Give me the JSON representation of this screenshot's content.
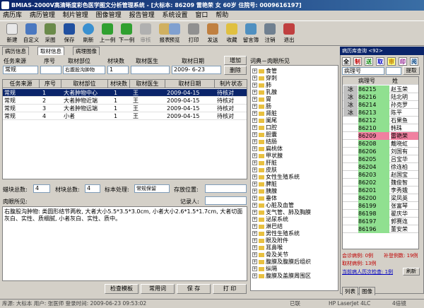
{
  "title": "BMIAS-2000V高清晰度彩色医学图文分析管理系统 - [大标本: 86209 雷艳荣 女 60岁 住院号: 0009616197]",
  "menu": [
    "病历库",
    "病历管理",
    "制片管理",
    "图像管理",
    "报告管理",
    "系统设置",
    "窗口",
    "帮助"
  ],
  "toolbar": [
    "新建",
    "自定义",
    "采图",
    "保存",
    "刷新",
    "上一例",
    "下一例",
    "审核",
    "报表",
    "预览",
    "打印",
    "发送",
    "收藏",
    "留言簿",
    "注销",
    "退出"
  ],
  "tabs": [
    "病历信息",
    "取材信息",
    "病理图像"
  ],
  "form": {
    "h_source": "任务来源",
    "h_seq": "序号",
    "h_part": "取材部位",
    "h_blocks": "材块数",
    "h_doctor": "取材医生",
    "h_date": "取材日期",
    "v_source": "常规",
    "v_part": "右腹股沟肿物",
    "v_blocks": "1",
    "v_date": "2009- 6-23",
    "add_btn": "增加",
    "del_btn": "删除"
  },
  "grid": {
    "headers": [
      "任务来源",
      "序号",
      "取材部位",
      "材块数",
      "取材医生",
      "取材日期",
      "制片状态"
    ],
    "rows": [
      [
        "常规",
        "1",
        "大者肿物中心",
        "1",
        "王",
        "2009-04-15",
        "待核对"
      ],
      [
        "常规",
        "2",
        "大者肿物近端",
        "1",
        "王",
        "2009-04-15",
        "待核对"
      ],
      [
        "常规",
        "3",
        "大者肿物远端",
        "1",
        "王",
        "2009-04-15",
        "待核对"
      ],
      [
        "常规",
        "4",
        "小者",
        "1",
        "王",
        "2009-04-15",
        "待核对"
      ]
    ]
  },
  "summary": {
    "l_wax": "蜡块总数:",
    "v_wax": "4",
    "l_material": "材块总数:",
    "v_material": "4",
    "l_proc": "标本处理:",
    "v_proc": "常规保留",
    "l_loc": "存放位置:",
    "l_naked": "肉眼所见:",
    "l_recorder": "记录人:"
  },
  "description": "右腹股沟肿物: 类圆形结节两枚, 大者大小5.5*3.5*3.0cm, 小者大小2.6*1.5*1.7cm, 大者切面灰白、实性、质细腻, 小者灰白、实性、质中。",
  "bottom_buttons": [
    "检查模板",
    "常用词",
    "保 存",
    "打 印"
  ],
  "tree_title": "词典－肉眼所见",
  "tree": [
    "食管",
    "穿刺",
    "肺",
    "乳腺",
    "胃",
    "肠",
    "肾脏",
    "阑尾",
    "口腔",
    "胆囊",
    "结肠",
    "扁桃体",
    "甲状腺",
    "肝脏",
    "皮肤",
    "女性生殖系统",
    "脾脏",
    "胰腺",
    "垂体",
    "心脏及血管",
    "支气管、肺及胸膜",
    "泌尿系统",
    "淋巴结",
    "男性生殖系统",
    "眼及附件",
    "耳鼻喉",
    "骨及关节",
    "腹膜及腹膜后组织",
    "纵隔",
    "腹膜及盖膜周围区"
  ],
  "right": {
    "title": "病历库查询 <92>",
    "letters": [
      "全",
      "制",
      "送",
      "取",
      "审",
      "印",
      "阅"
    ],
    "search_field": "病理号",
    "refresh_btn": "提取",
    "col_no": "病理号",
    "col_name": "姓",
    "patients": [
      [
        "冰",
        "86215",
        "赵玉荣"
      ],
      [
        "冰",
        "86216",
        "陆北明"
      ],
      [
        "冰",
        "86214",
        "孙克罗"
      ],
      [
        "冰",
        "86213",
        "陈平"
      ],
      [
        "",
        "86212",
        "石果鱼"
      ],
      [
        "",
        "86210",
        "韩珠"
      ],
      [
        "",
        "86209",
        "雷艳荣"
      ],
      [
        "",
        "86208",
        "戴晓虹"
      ],
      [
        "",
        "86206",
        "刘国有"
      ],
      [
        "",
        "86205",
        "吕宝华"
      ],
      [
        "",
        "86204",
        "徐连柏"
      ],
      [
        "",
        "86203",
        "赵国宝"
      ],
      [
        "",
        "86202",
        "魏俊智"
      ],
      [
        "",
        "86201",
        "李秀娥"
      ],
      [
        "",
        "86200",
        "梁凤英"
      ],
      [
        "",
        "86199",
        "张富琴"
      ],
      [
        "",
        "86198",
        "翟庆华"
      ],
      [
        "",
        "86197",
        "郭赛连"
      ],
      [
        "",
        "86196",
        "董安荣"
      ]
    ],
    "count1": "会诊病例: 0例",
    "count2": "补登例数: 19例",
    "count3": "取材病例: 13例",
    "count4": "当前病人历次检查: 1例",
    "refresh": "刷新",
    "tab1": "列表",
    "tab2": "图像"
  },
  "status": {
    "text": "库源: 大标本  用户: 张医师  登录时间: 2009-06-23 09:53:02",
    "printer": "HP LaserJet 4LC",
    "conn": "已联",
    "zoom": "4倍镜"
  }
}
